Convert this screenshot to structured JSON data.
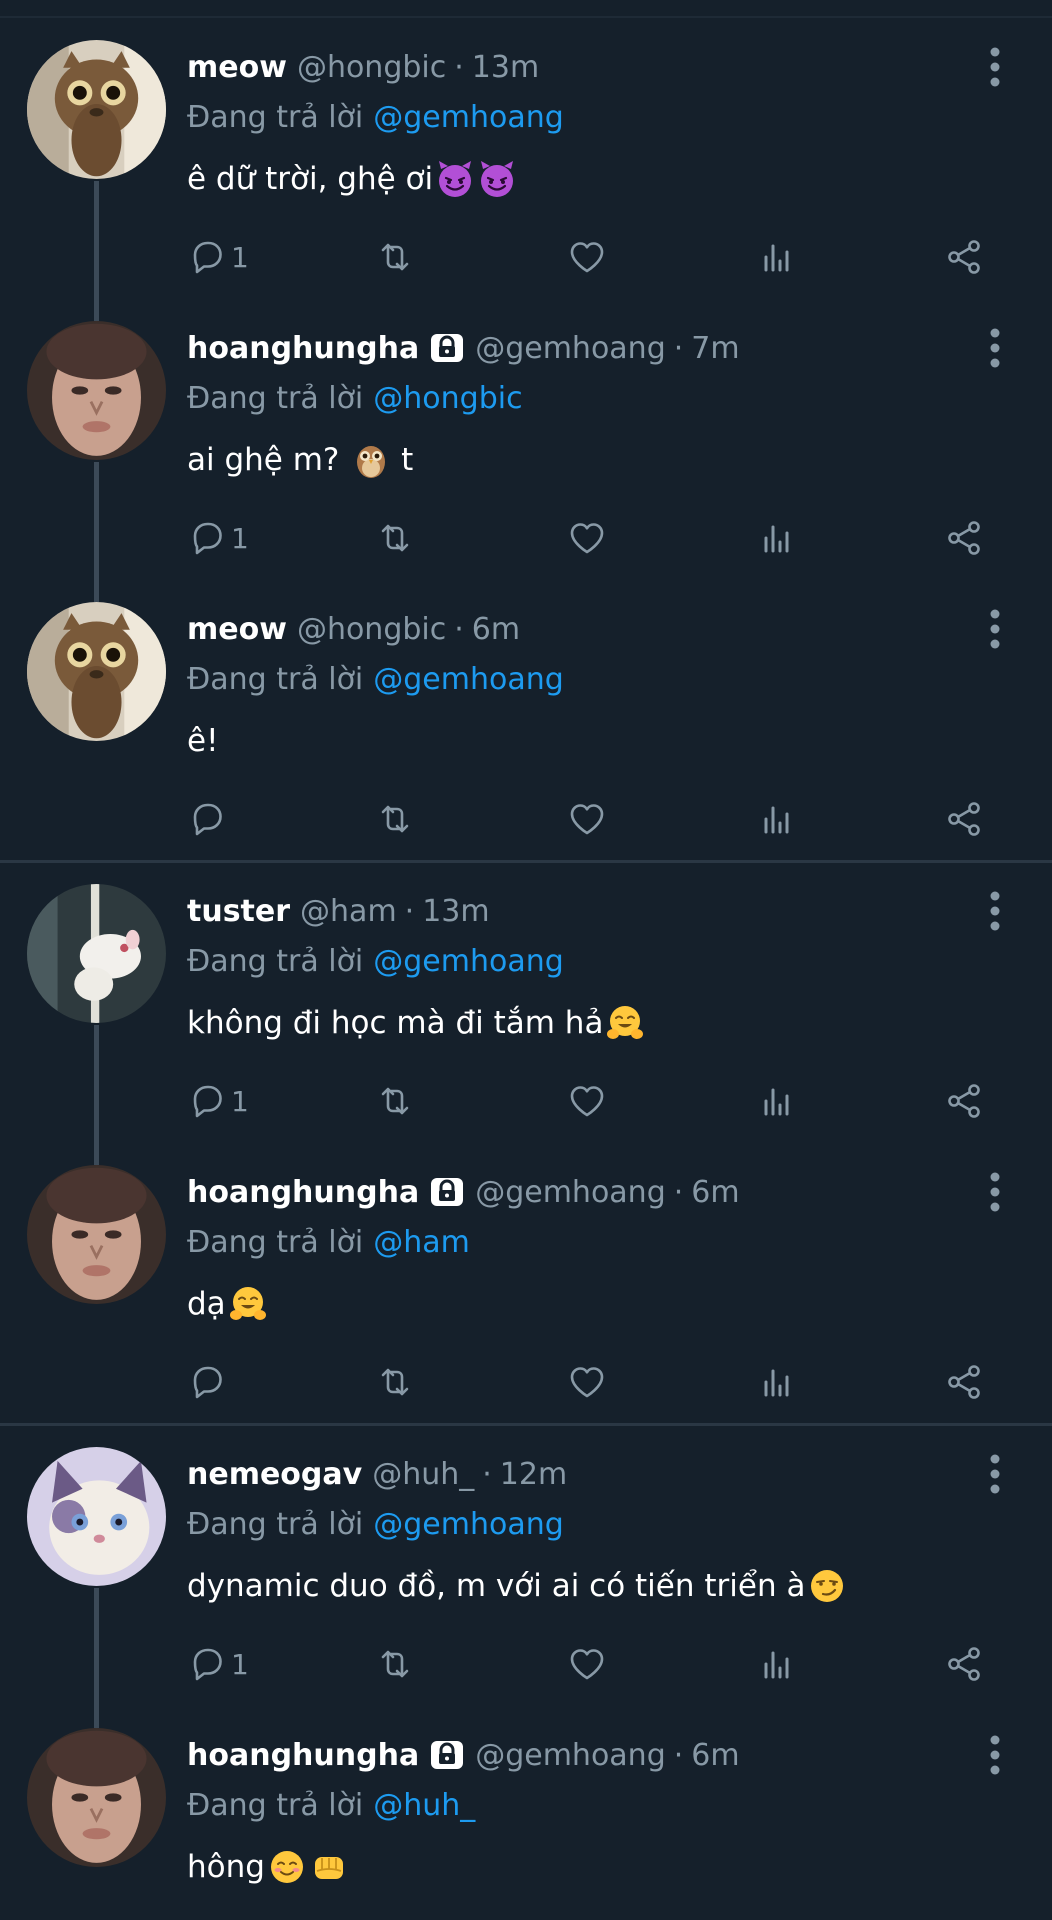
{
  "ui": {
    "replying_label": "Đang trả lời",
    "colors": {
      "background": "#15202b",
      "mention": "#1d9bf0",
      "muted": "#8899a6",
      "divider": "#2a3744",
      "thread_line": "#3c4a58"
    }
  },
  "tweets": [
    {
      "name": "meow",
      "handle": "@hongbic",
      "time": "13m",
      "locked": false,
      "replying_to": "@gemhoang",
      "text": "ê dữ trời, ghệ ơi",
      "emojis": [
        "smiling-imp-emoji",
        "smiling-imp-emoji"
      ],
      "reply_count": "1",
      "avatar": "cat-avatar"
    },
    {
      "name": "hoanghungha",
      "handle": "@gemhoang",
      "time": "7m",
      "locked": true,
      "replying_to": "@hongbic",
      "text": "ai ghệ m? ",
      "emojis": [
        "owl-emoji"
      ],
      "text_after": " t",
      "reply_count": "1",
      "avatar": "person-avatar"
    },
    {
      "name": "meow",
      "handle": "@hongbic",
      "time": "6m",
      "locked": false,
      "replying_to": "@gemhoang",
      "text": "ê!",
      "emojis": [],
      "reply_count": "",
      "avatar": "cat-avatar"
    },
    {
      "name": "tuster",
      "handle": "@ham",
      "time": "13m",
      "locked": false,
      "replying_to": "@gemhoang",
      "text": "không đi học mà đi tắm hả",
      "emojis": [
        "hugging-face-emoji"
      ],
      "reply_count": "1",
      "avatar": "rat-avatar"
    },
    {
      "name": "hoanghungha",
      "handle": "@gemhoang",
      "time": "6m",
      "locked": true,
      "replying_to": "@ham",
      "text": "dạ",
      "emojis": [
        "hugging-face-emoji"
      ],
      "reply_count": "",
      "avatar": "person-avatar"
    },
    {
      "name": "nemeogav",
      "handle": "@huh_",
      "time": "12m",
      "locked": false,
      "replying_to": "@gemhoang",
      "text": "dynamic duo đồ, m với ai có tiến triển à",
      "emojis": [
        "smirking-face-emoji"
      ],
      "reply_count": "1",
      "avatar": "kitten-avatar"
    },
    {
      "name": "hoanghungha",
      "handle": "@gemhoang",
      "time": "6m",
      "locked": true,
      "replying_to": "@huh_",
      "text": "hông",
      "emojis": [
        "smiling-face-emoji",
        "fist-emoji"
      ],
      "reply_count": "",
      "avatar": "person-avatar"
    }
  ]
}
